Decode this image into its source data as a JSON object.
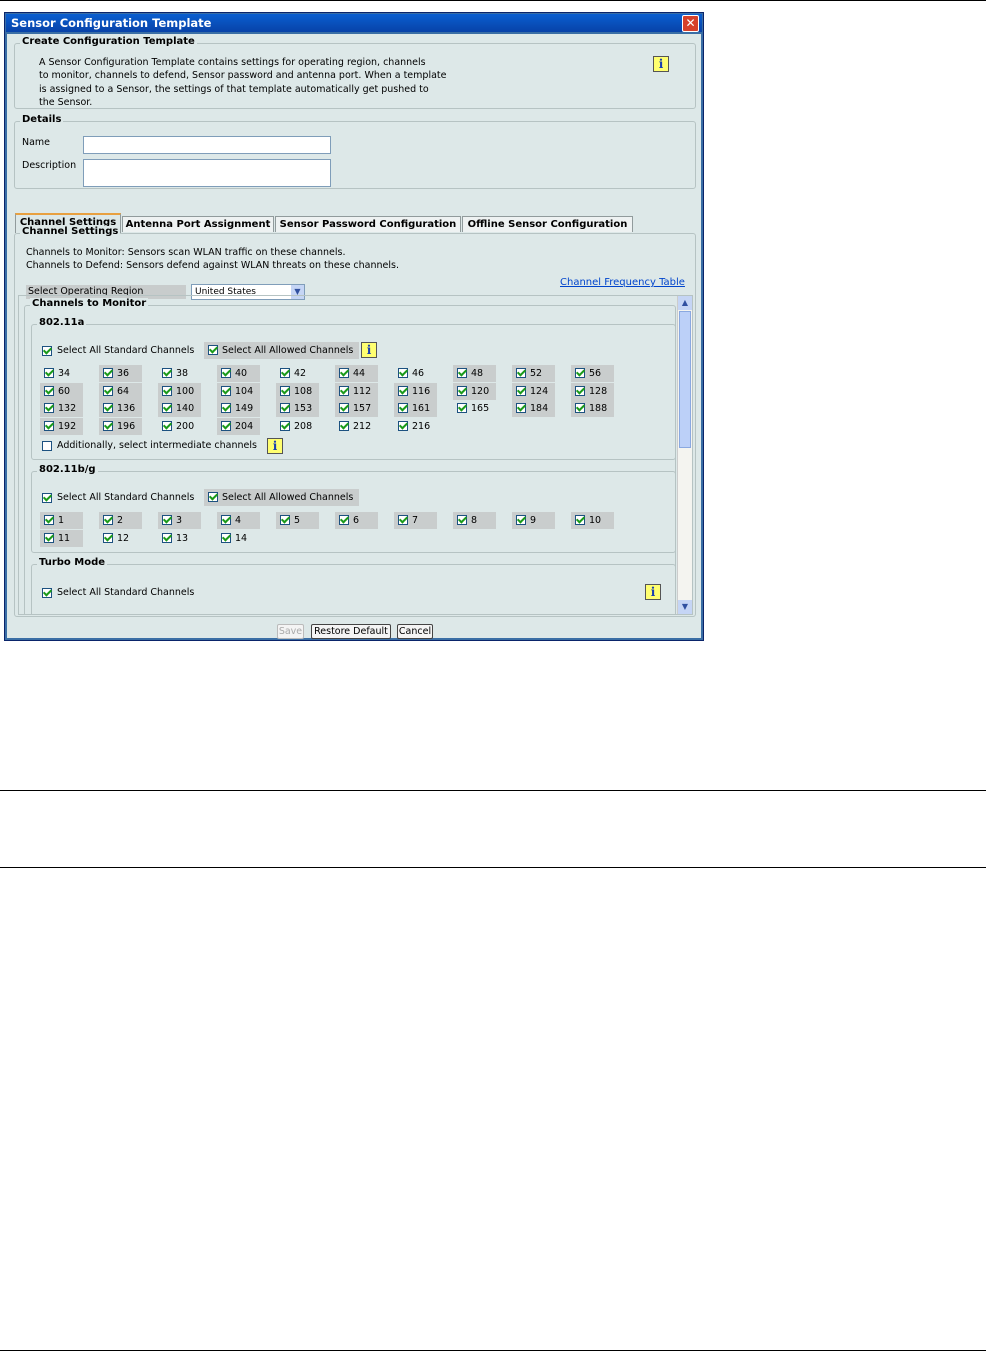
{
  "window": {
    "title": "Sensor Configuration Template",
    "close_symbol": "✕"
  },
  "create": {
    "legend": "Create Configuration Template",
    "description_lines": [
      "A Sensor Configuration Template contains settings for operating region, channels",
      "to monitor, channels to defend, Sensor password and antenna port. When a template",
      "is assigned to a Sensor, the settings of that template automatically get pushed to",
      "the Sensor."
    ]
  },
  "details": {
    "legend": "Details",
    "name_label": "Name",
    "name_value": "",
    "description_label": "Description",
    "description_value": ""
  },
  "tabs": [
    "Channel Settings",
    "Antenna Port Assignment",
    "Sensor Password Configuration",
    "Offline Sensor Configuration"
  ],
  "channel_settings": {
    "legend": "Channel Settings",
    "line1": "Channels to Monitor: Sensors scan WLAN traffic on these channels.",
    "line2": "Channels to Defend: Sensors defend against WLAN threats on these channels.",
    "region_label": "Select Operating Region",
    "region_value": "United States",
    "freq_link": "Channel Frequency Table"
  },
  "monitor": {
    "legend": "Channels to Monitor",
    "a": {
      "legend": "802.11a",
      "select_standard": "Select All Standard Channels",
      "select_allowed": "Select All Allowed Channels",
      "channels": [
        "34",
        "36",
        "38",
        "40",
        "42",
        "44",
        "46",
        "48",
        "52",
        "56",
        "60",
        "64",
        "100",
        "104",
        "108",
        "112",
        "116",
        "120",
        "124",
        "128",
        "132",
        "136",
        "140",
        "149",
        "153",
        "157",
        "161",
        "165",
        "184",
        "188",
        "192",
        "196",
        "200",
        "204",
        "208",
        "212",
        "216"
      ],
      "intermediate": "Additionally, select intermediate channels"
    },
    "bg": {
      "legend": "802.11b/g",
      "select_standard": "Select All Standard Channels",
      "select_allowed": "Select All Allowed Channels",
      "channels": [
        "1",
        "2",
        "3",
        "4",
        "5",
        "6",
        "7",
        "8",
        "9",
        "10",
        "11",
        "12",
        "13",
        "14"
      ]
    },
    "turbo": {
      "legend": "Turbo Mode",
      "select_standard": "Select All Standard Channels"
    }
  },
  "buttons": {
    "save": "Save",
    "restore": "Restore Default",
    "cancel": "Cancel"
  },
  "info_glyph": "i",
  "scroll_up": "▲",
  "scroll_down": "▼",
  "dropdown_arrow": "▼"
}
